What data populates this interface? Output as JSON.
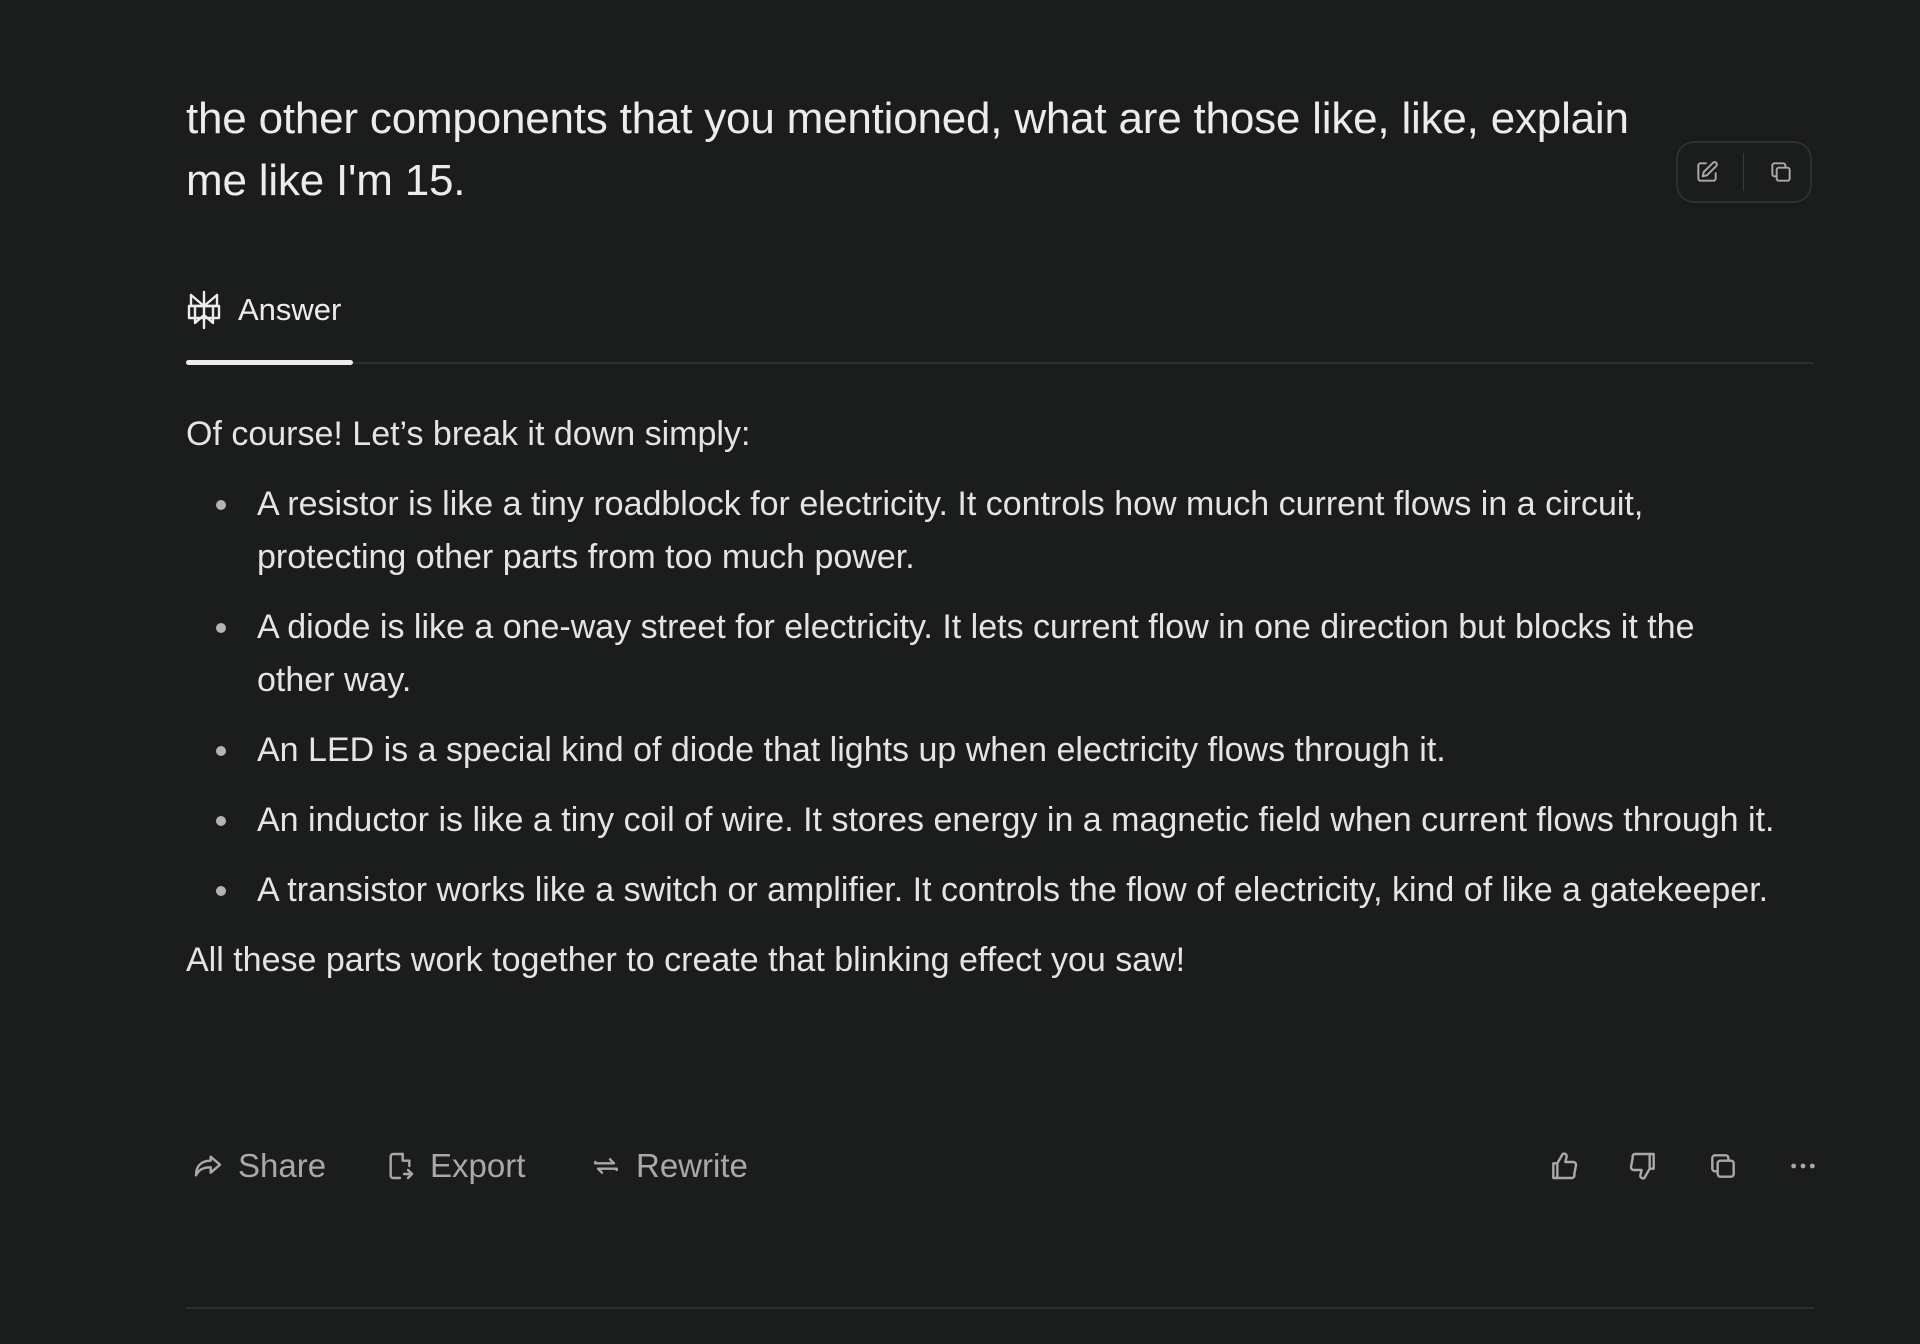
{
  "question": {
    "text": "the other components that you mentioned, what are those like, like, explain me like I'm 15."
  },
  "tabs": {
    "answer_label": "Answer"
  },
  "answer": {
    "intro": "Of course! Let’s break it down simply:",
    "items": [
      "A resistor is like a tiny roadblock for electricity. It controls how much current flows in a circuit, protecting other parts from too much power.",
      "A diode is like a one-way street for electricity. It lets current flow in one direction but blocks it the other way.",
      "An LED is a special kind of diode that lights up when electricity flows through it.",
      "An inductor is like a tiny coil of wire. It stores energy in a magnetic field when current flows through it.",
      "A transistor works like a switch or amplifier. It controls the flow of electricity, kind of like a gatekeeper."
    ],
    "outro": "All these parts work together to create that blinking effect you saw!"
  },
  "actions": {
    "share_label": "Share",
    "export_label": "Export",
    "rewrite_label": "Rewrite"
  },
  "icons": {
    "edit": "edit-icon",
    "copy_question": "copy-icon",
    "answer_tab": "perplexity-logo-icon",
    "share": "share-icon",
    "export": "export-file-icon",
    "rewrite": "rewrite-icon",
    "thumbs_up": "thumbs-up-icon",
    "thumbs_down": "thumbs-down-icon",
    "copy_answer": "copy-icon",
    "more": "more-icon"
  },
  "colors": {
    "background": "#1b1c1c",
    "text": "#e4e4e1",
    "muted": "#a9a9a6",
    "divider": "#2d2e2e"
  }
}
